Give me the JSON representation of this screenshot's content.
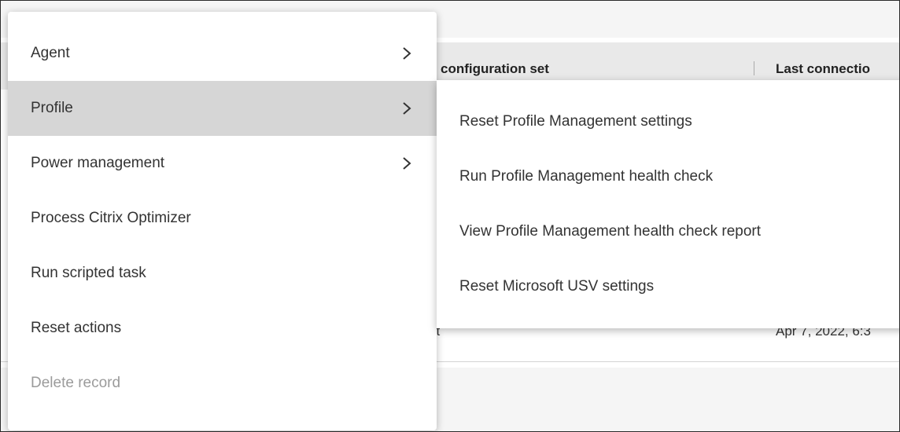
{
  "table": {
    "columns": [
      "configuration set",
      "Last connectio"
    ],
    "row": {
      "cell_left": "st",
      "cell_right": "Apr 7, 2022, 6:3"
    }
  },
  "menu": {
    "items": [
      {
        "label": "Agent",
        "has_submenu": true,
        "active": false,
        "disabled": false
      },
      {
        "label": "Profile",
        "has_submenu": true,
        "active": true,
        "disabled": false
      },
      {
        "label": "Power management",
        "has_submenu": true,
        "active": false,
        "disabled": false
      },
      {
        "label": "Process Citrix Optimizer",
        "has_submenu": false,
        "active": false,
        "disabled": false
      },
      {
        "label": "Run scripted task",
        "has_submenu": false,
        "active": false,
        "disabled": false
      },
      {
        "label": "Reset actions",
        "has_submenu": false,
        "active": false,
        "disabled": false
      },
      {
        "label": "Delete record",
        "has_submenu": false,
        "active": false,
        "disabled": true
      }
    ],
    "chevron_icon": "chevron-right-icon"
  },
  "submenu": {
    "items": [
      {
        "label": "Reset Profile Management settings"
      },
      {
        "label": "Run Profile Management health check"
      },
      {
        "label": "View Profile Management health check report"
      },
      {
        "label": "Reset Microsoft USV settings"
      }
    ]
  },
  "colors": {
    "active_background": "#d6d6d6",
    "disabled_text": "#9b9b9b",
    "text": "#333333"
  }
}
